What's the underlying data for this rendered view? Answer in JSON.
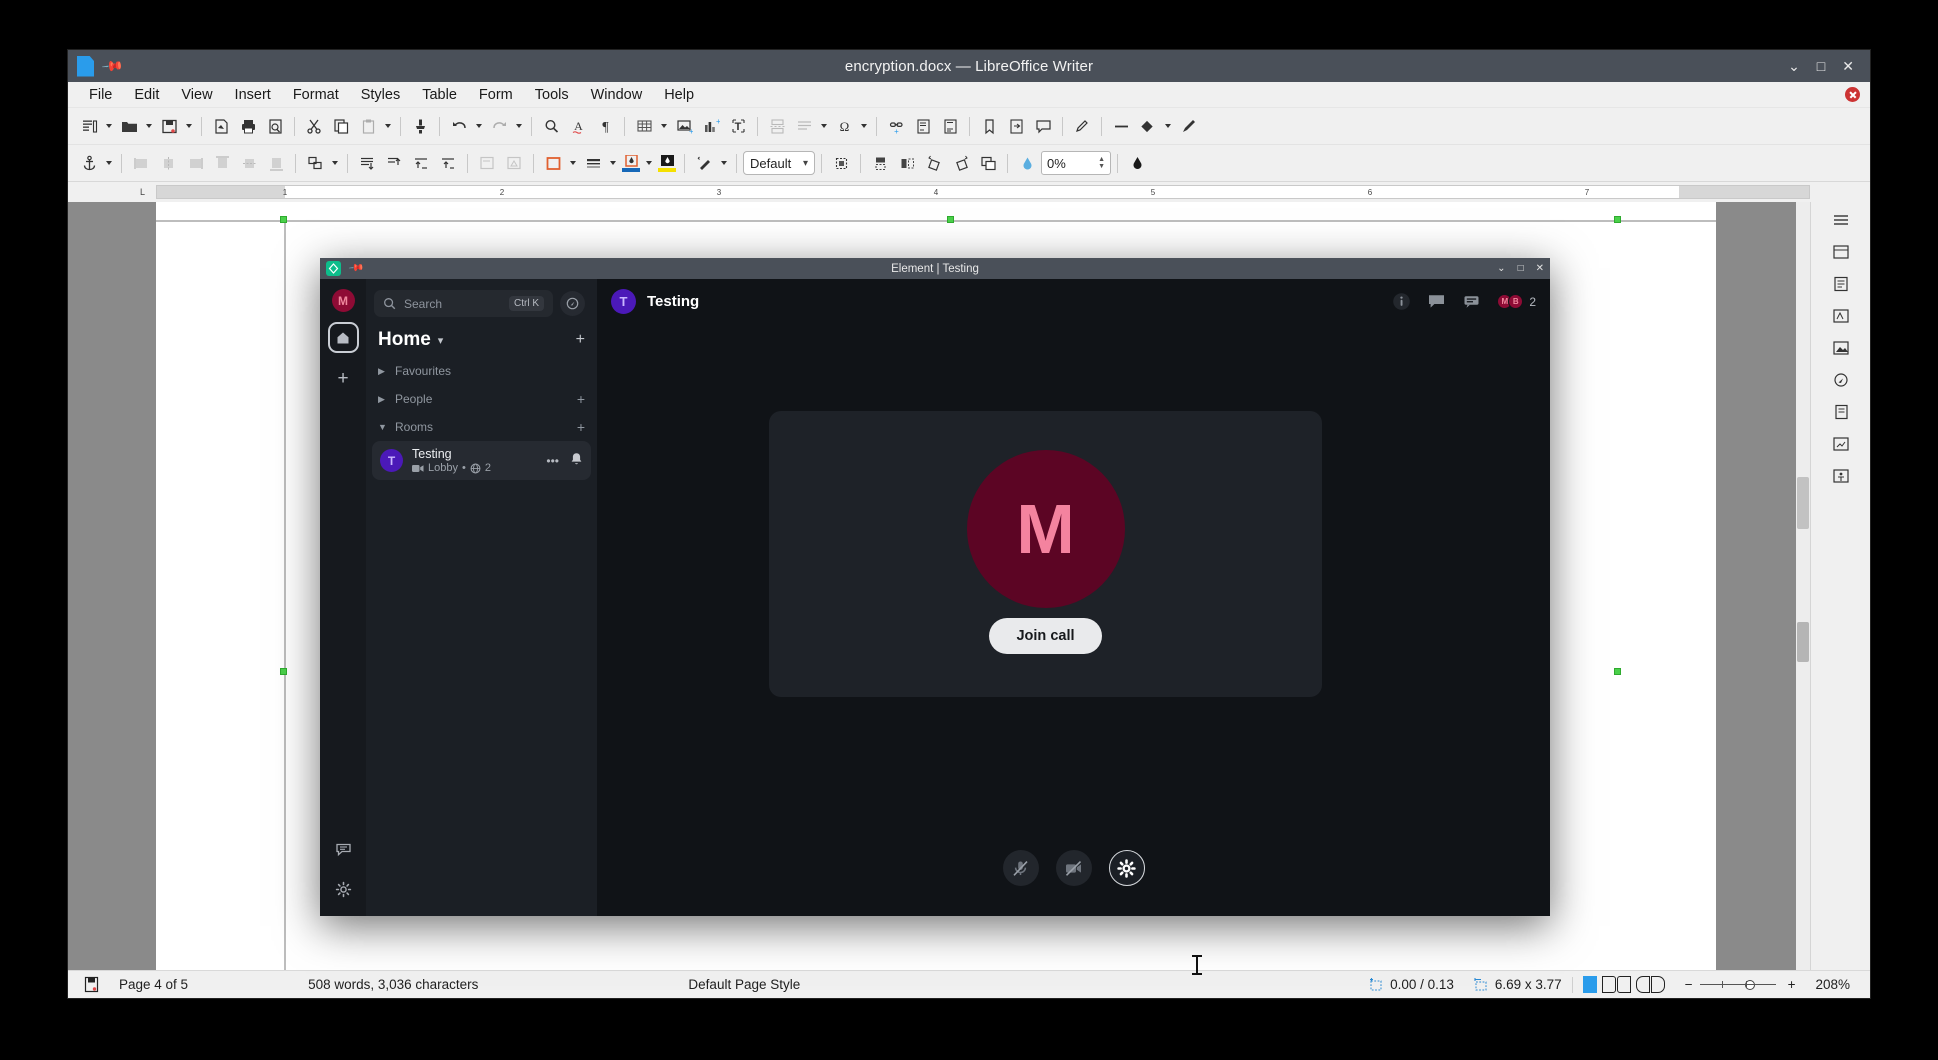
{
  "writer": {
    "title": "encryption.docx — LibreOffice Writer",
    "doc_icon": "document-icon",
    "pin_icon": "pin-icon",
    "window_buttons": {
      "minimize": "⌄",
      "maximize": "□",
      "close": "✕"
    },
    "menus": [
      {
        "label": "File"
      },
      {
        "label": "Edit"
      },
      {
        "label": "View"
      },
      {
        "label": "Insert"
      },
      {
        "label": "Format"
      },
      {
        "label": "Styles"
      },
      {
        "label": "Table"
      },
      {
        "label": "Form"
      },
      {
        "label": "Tools"
      },
      {
        "label": "Window"
      },
      {
        "label": "Help"
      }
    ],
    "toolbar_row1": [
      {
        "name": "new-document",
        "icon": "new-doc-icon",
        "caret": true
      },
      {
        "name": "open-document",
        "icon": "folder-icon",
        "caret": true
      },
      {
        "name": "save-document",
        "icon": "save-icon",
        "caret": true
      },
      {
        "name": "separator"
      },
      {
        "name": "export-pdf",
        "icon": "pdf-icon"
      },
      {
        "name": "print",
        "icon": "printer-icon"
      },
      {
        "name": "print-preview",
        "icon": "print-preview-icon"
      },
      {
        "name": "separator"
      },
      {
        "name": "cut",
        "icon": "scissors-icon"
      },
      {
        "name": "copy",
        "icon": "copy-icon"
      },
      {
        "name": "paste",
        "icon": "clipboard-icon",
        "caret": true,
        "disabled": true
      },
      {
        "name": "separator"
      },
      {
        "name": "clone-formatting",
        "icon": "paintbrush-icon"
      },
      {
        "name": "separator"
      },
      {
        "name": "undo",
        "icon": "undo-icon",
        "caret": true
      },
      {
        "name": "redo",
        "icon": "redo-icon",
        "caret": true,
        "disabled": true
      },
      {
        "name": "separator"
      },
      {
        "name": "find-replace",
        "icon": "magnifier-icon"
      },
      {
        "name": "spelling",
        "icon": "spellcheck-icon"
      },
      {
        "name": "formatting-marks",
        "icon": "pilcrow-icon"
      },
      {
        "name": "separator"
      },
      {
        "name": "insert-table",
        "icon": "table-icon",
        "caret": true
      },
      {
        "name": "insert-image",
        "icon": "image-icon"
      },
      {
        "name": "insert-chart",
        "icon": "chart-icon"
      },
      {
        "name": "insert-textbox",
        "icon": "textbox-icon"
      },
      {
        "name": "separator"
      },
      {
        "name": "insert-page-break",
        "icon": "page-break-icon"
      },
      {
        "name": "insert-field",
        "icon": "field-icon",
        "caret": true
      },
      {
        "name": "special-character",
        "icon": "omega-icon",
        "caret": true
      },
      {
        "name": "separator"
      },
      {
        "name": "insert-hyperlink",
        "icon": "link-icon"
      },
      {
        "name": "insert-footnote",
        "icon": "footnote-icon"
      },
      {
        "name": "insert-endnote",
        "icon": "endnote-icon"
      },
      {
        "name": "separator"
      },
      {
        "name": "insert-bookmark",
        "icon": "bookmark-icon"
      },
      {
        "name": "insert-crossref",
        "icon": "crossref-icon"
      },
      {
        "name": "insert-comment",
        "icon": "comment-icon"
      },
      {
        "name": "separator"
      },
      {
        "name": "track-changes",
        "icon": "track-changes-icon"
      },
      {
        "name": "separator"
      },
      {
        "name": "insert-line",
        "icon": "line-icon"
      },
      {
        "name": "basic-shapes",
        "icon": "shapes-icon",
        "caret": true
      },
      {
        "name": "show-draw-functions",
        "icon": "draw-icon"
      }
    ],
    "toolbar_row2": {
      "anchor": "anchor-icon",
      "align_icons": [
        "align-left",
        "align-center",
        "align-right",
        "align-justify",
        "align-top",
        "align-bottom"
      ],
      "arrange": "arrange-icon",
      "wrap_icons": [
        "wrap-off",
        "wrap-on",
        "wrap-through",
        "wrap-optimal"
      ],
      "borders_label": "borders",
      "style_select": "Default",
      "transparency_value": "0%"
    },
    "ruler_numbers": [
      "1",
      "2",
      "3",
      "4",
      "5",
      "6",
      "7"
    ],
    "statusbar": {
      "save_icon": "save-status-icon",
      "page": "Page 4 of 5",
      "words": "508 words, 3,036 characters",
      "page_style": "Default Page Style",
      "selection_mode": "",
      "position": "0.00 / 0.13",
      "size": "6.69 x 3.77",
      "view_single": "single-page-view-icon",
      "view_multi": "multi-page-view-icon",
      "view_book": "book-view-icon",
      "zoom_out": "−",
      "zoom_in": "+",
      "zoom": "208%"
    },
    "sidebar_icons": [
      "sidebar-settings-icon",
      "properties-icon",
      "page-icon",
      "styles-icon",
      "gallery-icon",
      "navigator-icon",
      "page-deck-icon",
      "style-inspector-icon",
      "accessibility-check-icon"
    ]
  },
  "element": {
    "titlebar": {
      "logo": "element-logo-icon",
      "pin": "pin-icon",
      "title": "Element | Testing",
      "minimize": "⌄",
      "maximize": "□",
      "close": "✕"
    },
    "spaces": {
      "user_avatar_letter": "M",
      "home_label": "home-icon",
      "add_space_label": "+",
      "threads_icon": "threads-activity-icon",
      "settings_icon": "gear-icon"
    },
    "roomlist": {
      "search": {
        "placeholder": "Search",
        "shortcut": "Ctrl K",
        "icon": "search-icon"
      },
      "explore_icon": "compass-icon",
      "header": {
        "title": "Home",
        "chevron": "⌄",
        "add": "+"
      },
      "sections": [
        {
          "name": "Favourites",
          "label": "Favourites",
          "expanded": false,
          "add": false
        },
        {
          "name": "People",
          "label": "People",
          "expanded": false,
          "add": true
        },
        {
          "name": "Rooms",
          "label": "Rooms",
          "expanded": true,
          "add": true
        }
      ],
      "rooms": [
        {
          "avatar_letter": "T",
          "name": "Testing",
          "subtitle_video_icon": "video-icon",
          "subtitle": "Lobby",
          "dot": "•",
          "members_icon": "public-icon",
          "members": "2",
          "overflow": "•••",
          "notification_icon": "bell-icon"
        }
      ]
    },
    "room": {
      "avatar_letter": "T",
      "name": "Testing",
      "header_icons": [
        "room-info-icon",
        "chat-icon",
        "threads-icon"
      ],
      "facepile": [
        "M",
        "B"
      ],
      "member_count": "2",
      "call": {
        "avatar_letter": "M",
        "join_label": "Join call",
        "controls": [
          {
            "name": "microphone-muted-icon",
            "state": "muted"
          },
          {
            "name": "camera-off-icon",
            "state": "off"
          },
          {
            "name": "gear-icon",
            "state": "active"
          }
        ]
      }
    }
  }
}
